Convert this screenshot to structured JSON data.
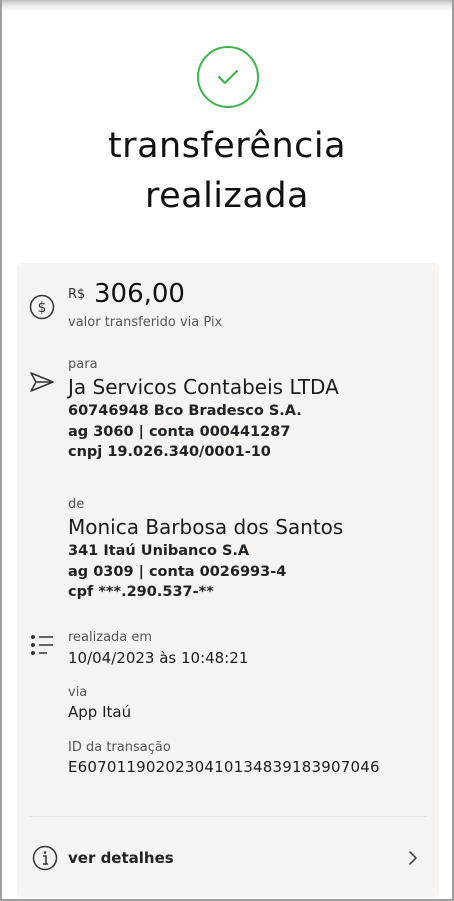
{
  "header": {
    "title_line1": "transferência",
    "title_line2": "realizada",
    "success_icon": "check-circle-icon",
    "accent_color": "#3cb44b"
  },
  "amount": {
    "currency": "R$",
    "value": "306,00",
    "caption": "valor transferido via Pix",
    "icon": "dollar-circle-icon"
  },
  "recipient": {
    "label": "para",
    "name": "Ja Servicos Contabeis LTDA",
    "bank": "60746948 Bco Bradesco S.A.",
    "account": "ag 3060 | conta 000441287",
    "document": "cnpj 19.026.340/0001-10",
    "icon": "send-icon"
  },
  "sender": {
    "label": "de",
    "name": "Monica Barbosa dos Santos",
    "bank": "341 Itaú Unibanco S.A",
    "account": "ag 0309 | conta 0026993-4",
    "document": "cpf ***.290.537-**"
  },
  "info": {
    "icon": "list-icon",
    "date_label": "realizada em",
    "date_value": "10/04/2023 às 10:48:21",
    "via_label": "via",
    "via_value": "App Itaú",
    "id_label": "ID da transação",
    "id_value": "E60701190202304101348391839070 46"
  },
  "details": {
    "label": "ver detalhes",
    "icon": "info-icon",
    "chevron": "chevron-right-icon"
  }
}
